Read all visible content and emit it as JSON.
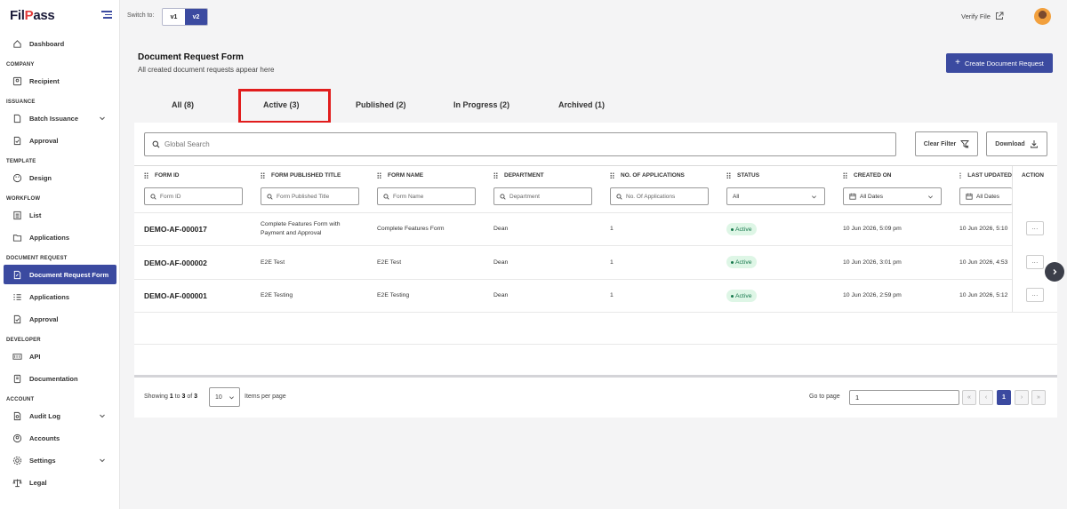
{
  "app": {
    "logo_main": "FilPass",
    "logo_accent": "P"
  },
  "sidebar": {
    "sections": [
      "COMPANY",
      "ISSUANCE",
      "TEMPLATE",
      "WORKFLOW",
      "DOCUMENT REQUEST",
      "DEVELOPER",
      "ACCOUNT"
    ],
    "items": [
      {
        "label": "Dashboard"
      },
      {
        "label": "Recipient"
      },
      {
        "label": "Batch Issuance"
      },
      {
        "label": "Approval"
      },
      {
        "label": "Design"
      },
      {
        "label": "List"
      },
      {
        "label": "Applications"
      },
      {
        "label": "Document Request Form"
      },
      {
        "label": "Applications"
      },
      {
        "label": "Approval"
      },
      {
        "label": "API"
      },
      {
        "label": "Documentation"
      },
      {
        "label": "Audit Log"
      },
      {
        "label": "Accounts"
      },
      {
        "label": "Settings"
      },
      {
        "label": "Legal"
      }
    ]
  },
  "topbar": {
    "switch_label": "Switch to:",
    "v1": "v1",
    "v2": "v2",
    "verify_file": "Verify File"
  },
  "header": {
    "title": "Document Request Form",
    "subtitle": "All created document requests appear here",
    "create_button": "Create Document Request"
  },
  "tabs": [
    {
      "label": "All (8)"
    },
    {
      "label": "Active (3)"
    },
    {
      "label": "Published (2)"
    },
    {
      "label": "In Progress (2)"
    },
    {
      "label": "Archived (1)"
    }
  ],
  "toolbar": {
    "search_placeholder": "Global Search",
    "clear_filter": "Clear Filter",
    "download": "Download"
  },
  "table": {
    "columns": [
      {
        "label": "FORM ID",
        "filter": "Form ID"
      },
      {
        "label": "FORM PUBLISHED TITLE",
        "filter": "Form Published Title"
      },
      {
        "label": "FORM NAME",
        "filter": "Form Name"
      },
      {
        "label": "DEPARTMENT",
        "filter": "Department"
      },
      {
        "label": "NO. OF APPLICATIONS",
        "filter": "No. Of Applications"
      },
      {
        "label": "STATUS",
        "filter": "All"
      },
      {
        "label": "CREATED ON",
        "filter": "All Dates"
      },
      {
        "label": "LAST UPDATED",
        "filter": "All Dates"
      },
      {
        "label": "ACTION"
      }
    ],
    "rows": [
      {
        "form_id": "DEMO-AF-000017",
        "title_line1": "Complete Features Form with",
        "title_line2": "Payment and Approval",
        "name": "Complete Features Form",
        "department": "Dean",
        "applications": "1",
        "status": "Active",
        "created": "10 Jun 2026, 5:09 pm",
        "updated": "10 Jun 2026, 5:10"
      },
      {
        "form_id": "DEMO-AF-000002",
        "title_line1": "E2E Test",
        "title_line2": "",
        "name": "E2E Test",
        "department": "Dean",
        "applications": "1",
        "status": "Active",
        "created": "10 Jun 2026, 3:01 pm",
        "updated": "10 Jun 2026, 4:53"
      },
      {
        "form_id": "DEMO-AF-000001",
        "title_line1": "E2E Testing",
        "title_line2": "",
        "name": "E2E Testing",
        "department": "Dean",
        "applications": "1",
        "status": "Active",
        "created": "10 Jun 2026, 2:59 pm",
        "updated": "10 Jun 2026, 5:12"
      }
    ],
    "action_label": "..."
  },
  "pagination": {
    "showing_prefix": "Showing",
    "from": "1",
    "to_word": "to",
    "to": "3",
    "of_word": "of",
    "total": "3",
    "per_page": "10",
    "items_per_page": "Items per page",
    "goto_label": "Go to page",
    "goto_value": "1",
    "first": "«",
    "prev": "‹",
    "current": "1",
    "next": "›",
    "last": "»"
  },
  "colors": {
    "primary": "#3b4aa0",
    "highlight": "#e11d1d",
    "status_active_bg": "#def6e6",
    "status_active_text": "#18794e"
  },
  "icons": [
    "hamburger-icon",
    "external-link-icon",
    "plus-icon",
    "search-icon",
    "filter-off-icon",
    "download-icon",
    "calendar-icon",
    "chevron-down-icon",
    "chevron-right-icon"
  ]
}
